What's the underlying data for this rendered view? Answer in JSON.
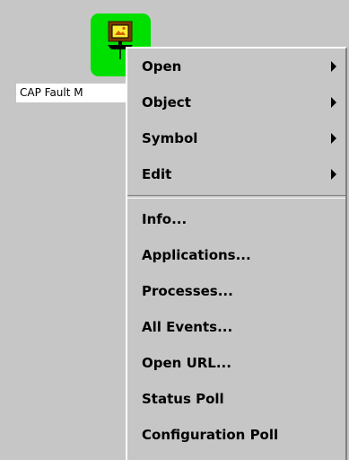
{
  "node": {
    "icon": "computer-monitor-icon",
    "icon_color": "#00e000",
    "label": "CAP Fault M"
  },
  "context_menu": {
    "submenu_items": [
      {
        "label": "Open",
        "icon": "submenu-arrow-icon"
      },
      {
        "label": "Object",
        "icon": "submenu-arrow-icon"
      },
      {
        "label": "Symbol",
        "icon": "submenu-arrow-icon"
      },
      {
        "label": "Edit",
        "icon": "submenu-arrow-icon"
      }
    ],
    "action_items": [
      {
        "label": "Info..."
      },
      {
        "label": "Applications..."
      },
      {
        "label": "Processes..."
      },
      {
        "label": "All Events..."
      },
      {
        "label": "Open URL..."
      },
      {
        "label": "Status Poll"
      },
      {
        "label": "Configuration Poll"
      }
    ]
  }
}
